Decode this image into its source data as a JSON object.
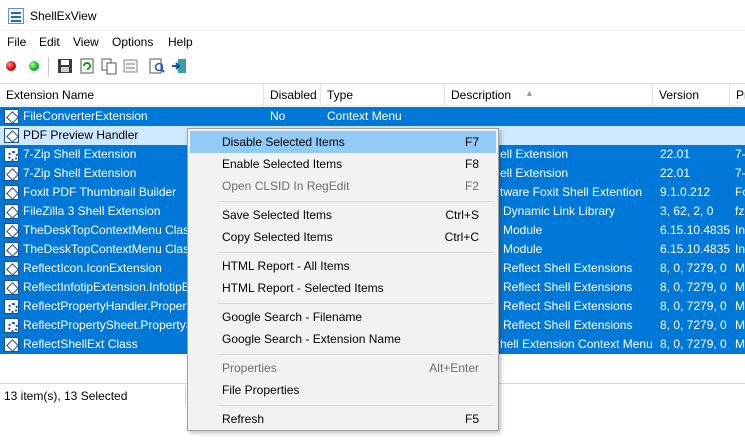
{
  "window": {
    "title": "ShellExView"
  },
  "menu": [
    "File",
    "Edit",
    "View",
    "Options",
    "Help"
  ],
  "toolbar": {
    "icons": [
      "red-dot-icon",
      "green-dot-icon",
      "save-icon",
      "refresh-icon",
      "copy-icon",
      "properties-icon",
      "find-icon",
      "exit-icon"
    ]
  },
  "columns": [
    "Extension Name",
    "Disabled",
    "Type",
    "Description",
    "Version",
    "Pr"
  ],
  "rows": [
    {
      "name": "FileConverterExtension",
      "disabled": "No",
      "type": "Context Menu",
      "description": "",
      "version": "",
      "product": ""
    },
    {
      "name": "PDF Preview Handler",
      "disabled": "",
      "type": "",
      "description": "",
      "version": "",
      "product": ""
    },
    {
      "name": "7-Zip Shell Extension",
      "disabled": "",
      "type": "",
      "description": "ell Extension",
      "version": "22.01",
      "product": "7-"
    },
    {
      "name": "7-Zip Shell Extension",
      "disabled": "",
      "type": "",
      "description": "ell Extension",
      "version": "22.01",
      "product": "7-"
    },
    {
      "name": "Foxit PDF Thumbnail Builder",
      "disabled": "",
      "type": "",
      "description": "tware Foxit  Shell Extention",
      "version": "9.1.0.212",
      "product": "Fo"
    },
    {
      "name": "FileZilla 3 Shell Extension",
      "disabled": "",
      "type": "",
      "description": "Dynamic Link Library",
      "version": "3, 62, 2, 0",
      "product": "fz"
    },
    {
      "name": "TheDeskTopContextMenu Class",
      "disabled": "",
      "type": "",
      "description": "Module",
      "version": "6.15.10.4835",
      "product": "In"
    },
    {
      "name": "TheDeskTopContextMenu Class",
      "disabled": "",
      "type": "",
      "description": "Module",
      "version": "6.15.10.4835",
      "product": "In"
    },
    {
      "name": "ReflectIcon.IconExtension",
      "disabled": "",
      "type": "",
      "description": "Reflect Shell Extensions",
      "version": "8, 0, 7279, 0",
      "product": "M"
    },
    {
      "name": "ReflectInfotipExtension.InfotipE",
      "disabled": "",
      "type": "",
      "description": "Reflect Shell Extensions",
      "version": "8, 0, 7279, 0",
      "product": "M"
    },
    {
      "name": "ReflectPropertyHandler.Propert",
      "disabled": "",
      "type": "",
      "description": "Reflect Shell Extensions",
      "version": "8, 0, 7279, 0",
      "product": "M"
    },
    {
      "name": "ReflectPropertySheet.PropertyS",
      "disabled": "",
      "type": "",
      "description": "Reflect Shell Extensions",
      "version": "8, 0, 7279, 0",
      "product": "M"
    },
    {
      "name": "ReflectShellExt Class",
      "disabled": "",
      "type": "",
      "description": "hell Extension Context Menu",
      "version": "8, 0, 7279, 0",
      "product": "M"
    }
  ],
  "status": "13 item(s), 13 Selected",
  "context_menu": {
    "groups": [
      [
        {
          "label": "Disable Selected Items",
          "shortcut": "F7",
          "state": "highlighted"
        },
        {
          "label": "Enable Selected Items",
          "shortcut": "F8",
          "state": "normal"
        },
        {
          "label": "Open CLSID In RegEdit",
          "shortcut": "F2",
          "state": "disabled"
        }
      ],
      [
        {
          "label": "Save Selected Items",
          "shortcut": "Ctrl+S",
          "state": "normal"
        },
        {
          "label": "Copy Selected Items",
          "shortcut": "Ctrl+C",
          "state": "normal"
        }
      ],
      [
        {
          "label": "HTML Report - All Items",
          "shortcut": "",
          "state": "normal"
        },
        {
          "label": "HTML Report - Selected Items",
          "shortcut": "",
          "state": "normal"
        }
      ],
      [
        {
          "label": "Google Search - Filename",
          "shortcut": "",
          "state": "normal"
        },
        {
          "label": "Google Search - Extension Name",
          "shortcut": "",
          "state": "normal"
        }
      ],
      [
        {
          "label": "Properties",
          "shortcut": "Alt+Enter",
          "state": "disabled"
        },
        {
          "label": "File Properties",
          "shortcut": "",
          "state": "normal"
        }
      ],
      [
        {
          "label": "Refresh",
          "shortcut": "F5",
          "state": "normal"
        }
      ]
    ]
  },
  "colors": {
    "selection": "#0078d7",
    "selection_inactive": "#cde8ff",
    "menu_highlight": "#91c9f7"
  }
}
